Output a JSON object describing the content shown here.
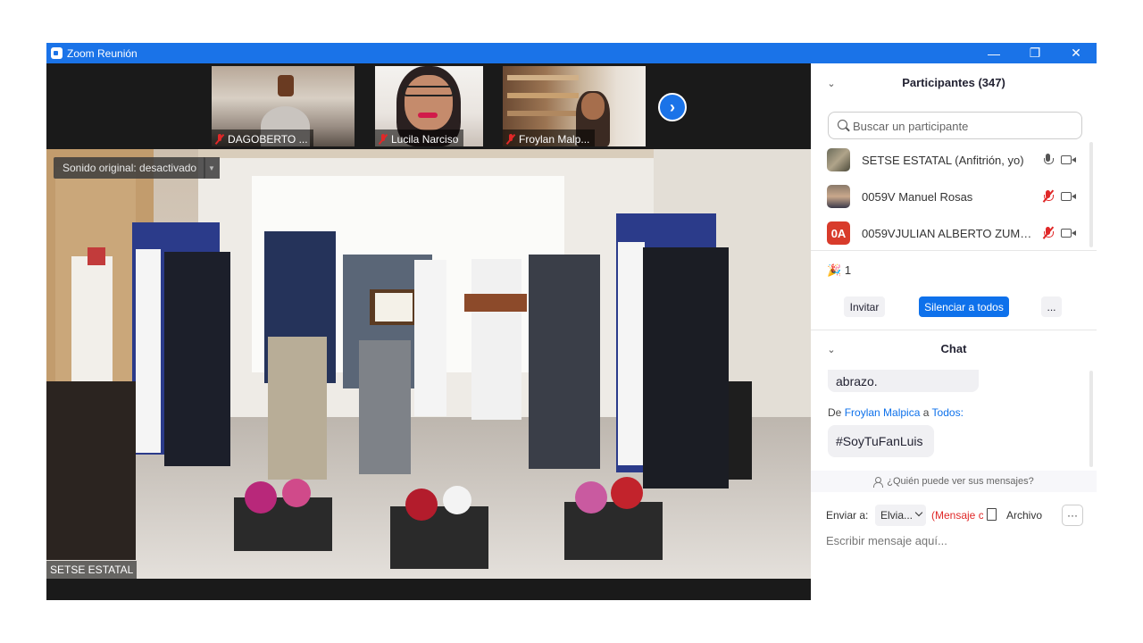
{
  "window": {
    "title": "Zoom Reunión",
    "controls": {
      "minimize": "—",
      "restore": "❐",
      "close": "✕"
    }
  },
  "gallery": {
    "thumbnails": [
      {
        "name": "DAGOBERTO ...",
        "muted": true
      },
      {
        "name": "Lucila Narciso",
        "muted": true
      },
      {
        "name": "Froylan Malp...",
        "muted": true
      }
    ],
    "next_icon": "›"
  },
  "main_video": {
    "audio_banner": "Sonido original: desactivado",
    "audio_dropdown": "▼",
    "speaker_name": "SETSE ESTATAL"
  },
  "participants": {
    "header": "Participantes (347)",
    "collapse_icon": "⌄",
    "search_placeholder": "Buscar un participante",
    "list": [
      {
        "name": "SETSE ESTATAL (Anfitrión, yo)",
        "mic": "on",
        "avatar_text": ""
      },
      {
        "name": "0059V Manuel Rosas",
        "mic": "muted",
        "avatar_text": ""
      },
      {
        "name": "0059VJULIAN ALBERTO ZUMAYA...",
        "mic": "muted",
        "avatar_text": "0A"
      }
    ],
    "reaction": {
      "icon": "🎉",
      "count": "1"
    },
    "buttons": {
      "invite": "Invitar",
      "mute_all": "Silenciar a todos",
      "more": "..."
    }
  },
  "chat": {
    "header": "Chat",
    "collapse_icon": "⌄",
    "messages": [
      {
        "text": "abrazo."
      },
      {
        "from_prefix": "De",
        "from": "Froylan Malpica",
        "to_prefix": "a",
        "to": "Todos:",
        "text": "#SoyTuFanLuis"
      }
    ],
    "who_can_see": "¿Quién puede ver sus mensajes?",
    "send_to_label": "Enviar a:",
    "send_to_value": "Elvia...",
    "private_label": "(Mensaje c",
    "file_label": "Archivo",
    "more_label": "···",
    "input_placeholder": "Escribir mensaje aquí..."
  },
  "colors": {
    "titlebar": "#1a73e8",
    "primary_button": "#0e71eb",
    "muted_red": "#e02828",
    "avatar_red": "#d83b2b"
  }
}
